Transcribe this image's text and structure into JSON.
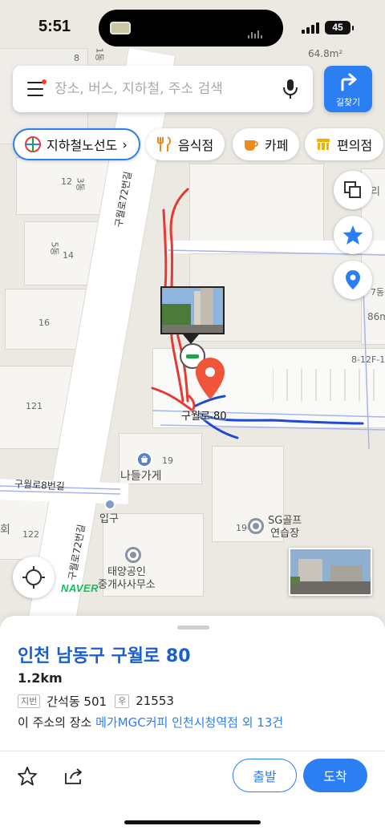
{
  "status_bar": {
    "time": "5:51",
    "battery": "45"
  },
  "search": {
    "placeholder": "장소, 버스, 지하철, 주소 검색"
  },
  "route_button": {
    "label": "길찾기"
  },
  "chips": [
    {
      "label": "지하철노선도",
      "icon": "subway-map-icon"
    },
    {
      "label": "음식점",
      "icon": "restaurant-icon"
    },
    {
      "label": "카페",
      "icon": "cafe-icon"
    },
    {
      "label": "편의점",
      "icon": "convenience-store-icon"
    }
  ],
  "map": {
    "area_label": "64.8m²",
    "road_labels": [
      "구월로72번길",
      "구월로8번길",
      "구월로72번길"
    ],
    "building_numbers": [
      "8",
      "12",
      "14",
      "16",
      "121",
      "19",
      "19-"
    ],
    "building_dong": [
      "1동",
      "3동",
      "5동"
    ],
    "partial_labels": [
      "리",
      "7동",
      "86m",
      "8-12F-1",
      "회",
      "122"
    ],
    "marker_label": "구월로 80",
    "pois": [
      {
        "name": "나들가게",
        "icon": "store-icon"
      },
      {
        "name": "입구",
        "icon": "entrance-icon"
      },
      {
        "name": "SG골프\n연습장",
        "icon": "poi-dot-icon"
      },
      {
        "name": "태양공인\n중개사사무소",
        "icon": "poi-dot-icon"
      }
    ],
    "brand": "NAVER",
    "route_colors": {
      "red": "#e53935",
      "blue": "#1e49d6"
    }
  },
  "sheet": {
    "title": "인천 남동구 구월로 80",
    "distance": "1.2km",
    "jibun_tag": "지번",
    "jibun": "간석동 501",
    "postal_tag": "우",
    "postal": "21553",
    "places_prefix": "이 주소의 장소",
    "places_link": "메가MGC커피 인천시청역점 외 13건",
    "depart_label": "출발",
    "arrive_label": "도착"
  },
  "colors": {
    "accent": "#2b7ff3",
    "marker": "#f0553a",
    "title_blue": "#1a5fcc"
  }
}
